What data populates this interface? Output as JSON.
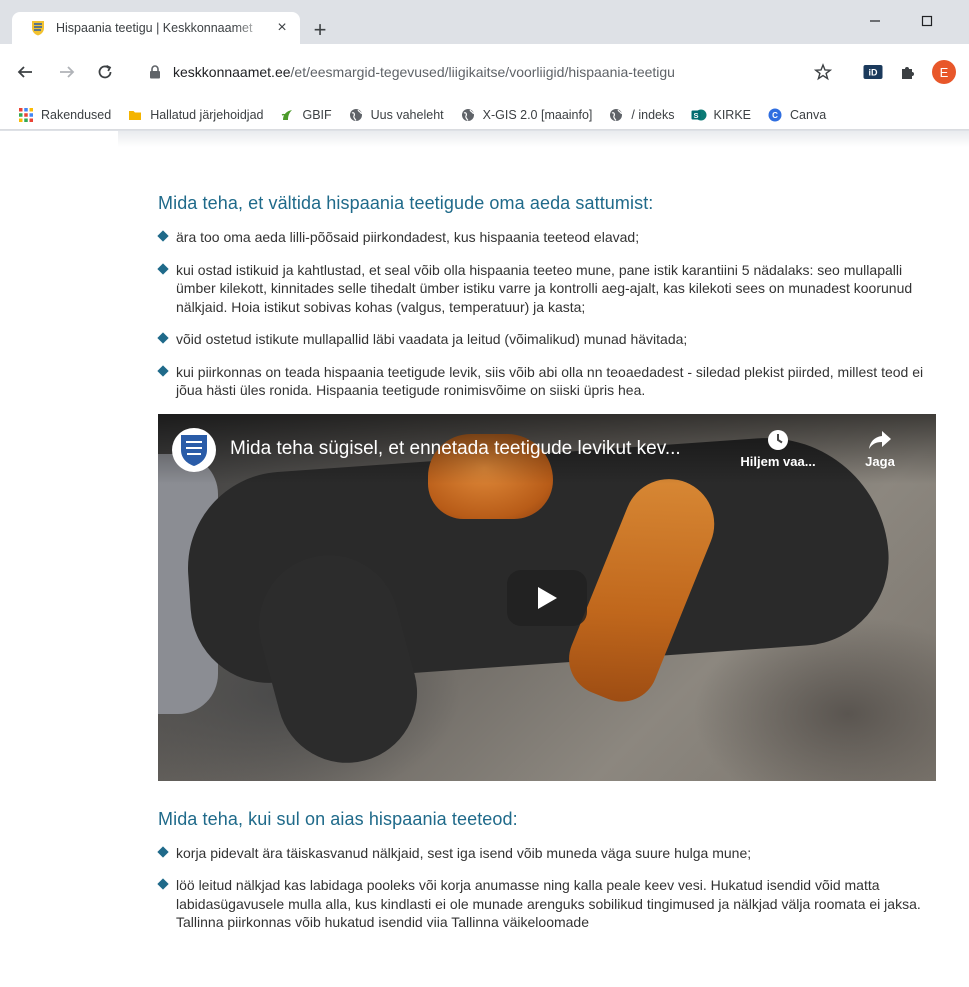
{
  "tab": {
    "title": "Hispaania teetigu | Keskkonnaamet",
    "close_symbol": "×",
    "new_tab_symbol": "+"
  },
  "toolbar": {
    "url_host": "keskkonnaamet.ee",
    "url_path": "/et/eesmargid-tegevused/liigikaitse/voorliigid/hispaania-teetigu",
    "profile_initial": "E"
  },
  "bookmarks": [
    {
      "label": "Rakendused",
      "icon": "apps-grid-icon"
    },
    {
      "label": "Hallatud järjehoidjad",
      "icon": "folder-icon"
    },
    {
      "label": "GBIF",
      "icon": "gbif-icon"
    },
    {
      "label": "Uus vaheleht",
      "icon": "globe-icon"
    },
    {
      "label": "X-GIS 2.0 [maainfo]",
      "icon": "globe-icon"
    },
    {
      "label": "/ indeks",
      "icon": "globe-icon"
    },
    {
      "label": "KIRKE",
      "icon": "sharepoint-icon"
    },
    {
      "label": "Canva",
      "icon": "canva-icon"
    }
  ],
  "section1": {
    "heading": "Mida teha, et vältida hispaania teetigude oma aeda sattumist:",
    "items": [
      "ära too oma aeda lilli-põõsaid piirkondadest, kus hispaania teeteod elavad;",
      "kui ostad istikuid ja kahtlustad, et seal võib olla hispaania teeteo mune, pane istik karantiini 5 nädalaks: seo mullapalli ümber kilekott, kinnitades selle tihedalt ümber istiku varre ja kontrolli aeg-ajalt, kas kilekoti sees on munadest koorunud nälkjaid. Hoia istikut sobivas kohas (valgus, temperatuur) ja kasta;",
      "võid ostetud istikute mullapallid läbi vaadata ja leitud (võimalikud) munad hävitada;",
      "kui piirkonnas on teada hispaania teetigude levik, siis võib abi olla nn teoaedadest - siledad plekist piirded, millest teod ei jõua hästi üles ronida. Hispaania teetigude ronimisvõime on siiski üpris hea."
    ]
  },
  "video": {
    "title": "Mida teha sügisel, et ennetada teetigude levikut kev...",
    "watch_later": "Hiljem vaa...",
    "share": "Jaga"
  },
  "section2": {
    "heading": "Mida teha, kui sul on aias hispaania teeteod:",
    "items": [
      "korja pidevalt ära täiskasvanud nälkjaid, sest iga isend võib muneda väga suure hulga mune;",
      "löö leitud nälkjad kas labidaga pooleks või korja anumasse ning kalla peale keev vesi. Hukatud isendid võid matta labidasügavusele mulla alla, kus kindlasti ei ole munade arenguks sobilikud tingimused ja nälkjad välja roomata ei jaksa. Tallinna piirkonnas võib hukatud isendid viia Tallinna väikeloomade"
    ]
  },
  "colors": {
    "heading": "#1f6a8a",
    "body_text": "#333333",
    "profile_badge": "#e8572a"
  }
}
